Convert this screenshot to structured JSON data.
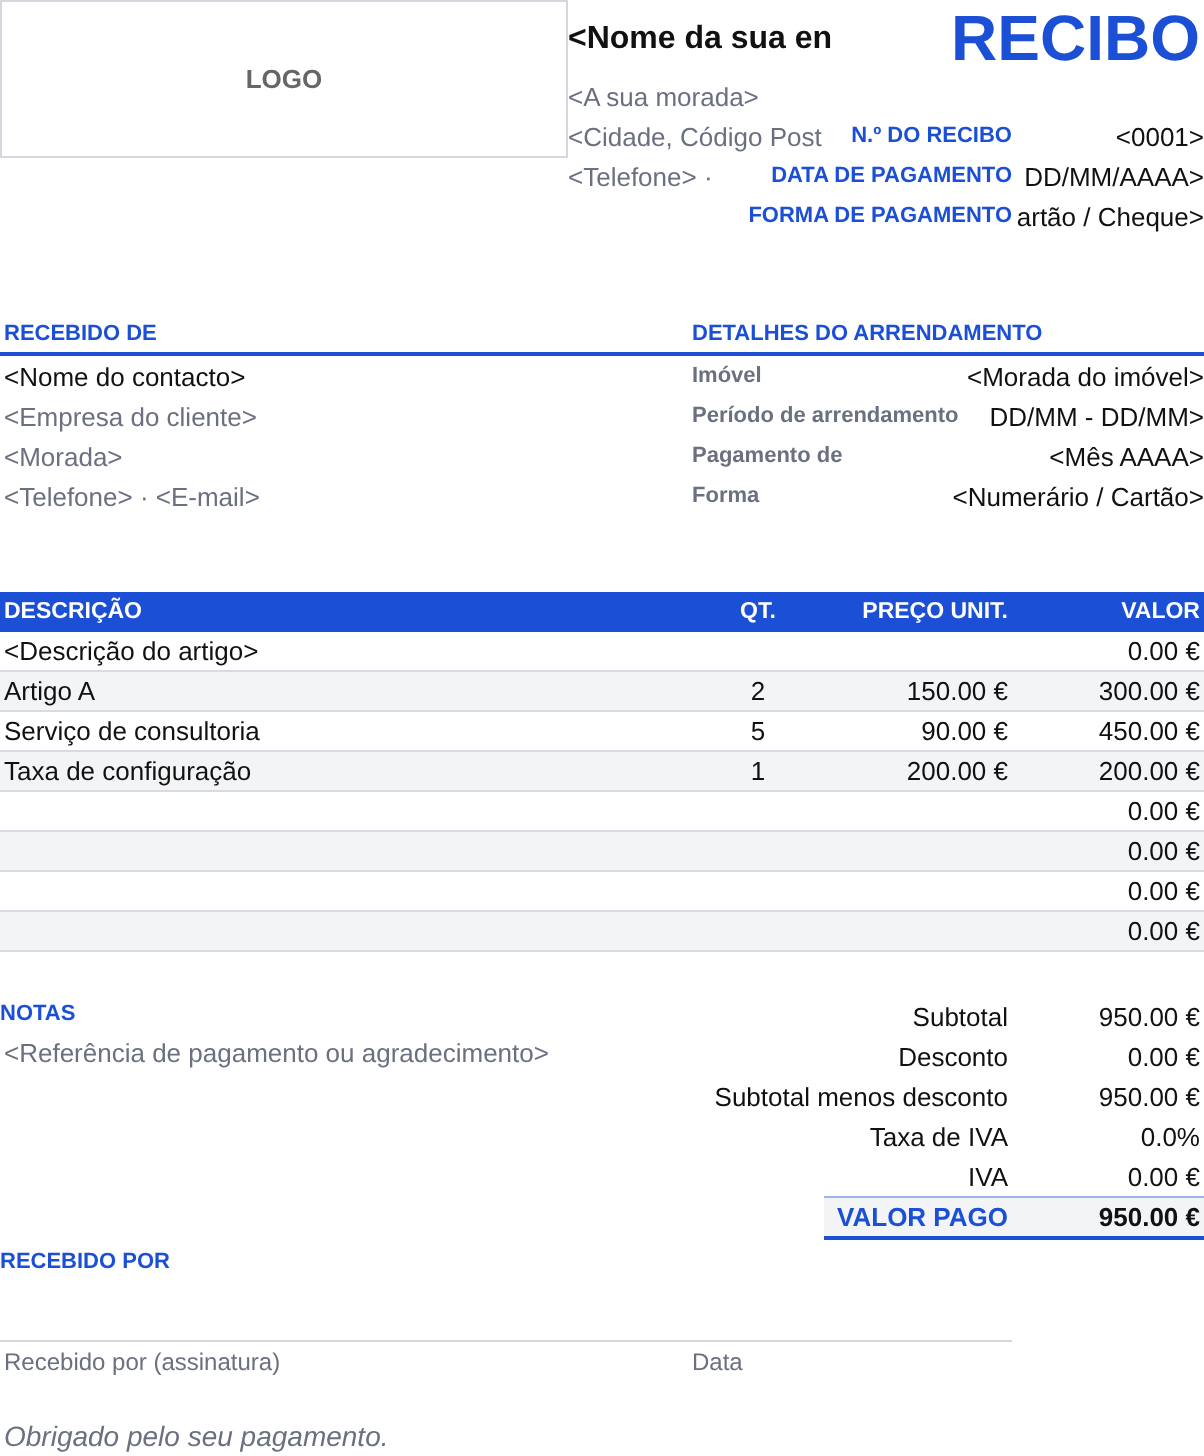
{
  "header": {
    "logo": "LOGO",
    "company_name": "<Nome da sua en",
    "title": "RECIBO",
    "address_lines": [
      "<A sua morada>",
      "<Cidade, Código Post",
      "<Telefone>  ·"
    ],
    "meta": [
      {
        "label": "N.º DO RECIBO",
        "value": "<0001>"
      },
      {
        "label": "DATA DE PAGAMENTO",
        "value": "DD/MM/AAAA>"
      },
      {
        "label": "FORMA DE PAGAMENTO",
        "value": "artão / Cheque>"
      }
    ]
  },
  "received_from": {
    "heading": "RECEBIDO DE",
    "lines": [
      {
        "text": "<Nome do contacto>",
        "kind": "primary"
      },
      {
        "text": "<Empresa do cliente>",
        "kind": "muted"
      },
      {
        "text": "<Morada>",
        "kind": "muted"
      },
      {
        "text": "<Telefone>  ·  <E-mail>",
        "kind": "muted"
      }
    ]
  },
  "rental_details": {
    "heading": "DETALHES DO ARRENDAMENTO",
    "rows": [
      {
        "label": "Imóvel",
        "value": "<Morada do imóvel>"
      },
      {
        "label": "Período de arrendamento",
        "value": "DD/MM - DD/MM>"
      },
      {
        "label": "Pagamento de",
        "value": "<Mês AAAA>"
      },
      {
        "label": "Forma",
        "value": "<Numerário / Cartão>"
      }
    ]
  },
  "table": {
    "columns": [
      "DESCRIÇÃO",
      "QT.",
      "PREÇO UNIT.",
      "VALOR"
    ],
    "rows": [
      [
        "<Descrição do artigo>",
        "",
        "",
        "0.00 €"
      ],
      [
        "Artigo A",
        "2",
        "150.00 €",
        "300.00 €"
      ],
      [
        "Serviço de consultoria",
        "5",
        "90.00 €",
        "450.00 €"
      ],
      [
        "Taxa de configuração",
        "1",
        "200.00 €",
        "200.00 €"
      ],
      [
        "",
        "",
        "",
        "0.00 €"
      ],
      [
        "",
        "",
        "",
        "0.00 €"
      ],
      [
        "",
        "",
        "",
        "0.00 €"
      ],
      [
        "",
        "",
        "",
        "0.00 €"
      ]
    ]
  },
  "notes": {
    "heading": "NOTAS",
    "text": "<Referência de pagamento ou agradecimento>"
  },
  "totals": [
    {
      "label": "Subtotal",
      "value": "950.00 €"
    },
    {
      "label": "Desconto",
      "value": "0.00 €"
    },
    {
      "label": "Subtotal menos desconto",
      "value": "950.00 €"
    },
    {
      "label": "Taxa de IVA",
      "value": "0.0%"
    },
    {
      "label": "IVA",
      "value": "0.00 €"
    }
  ],
  "total_paid": {
    "label": "VALOR PAGO",
    "value": "950.00 €"
  },
  "received_by": {
    "heading": "RECEBIDO POR",
    "signature_label": "Recebido por (assinatura)",
    "date_label": "Data"
  },
  "footer": "Obrigado pelo seu pagamento."
}
